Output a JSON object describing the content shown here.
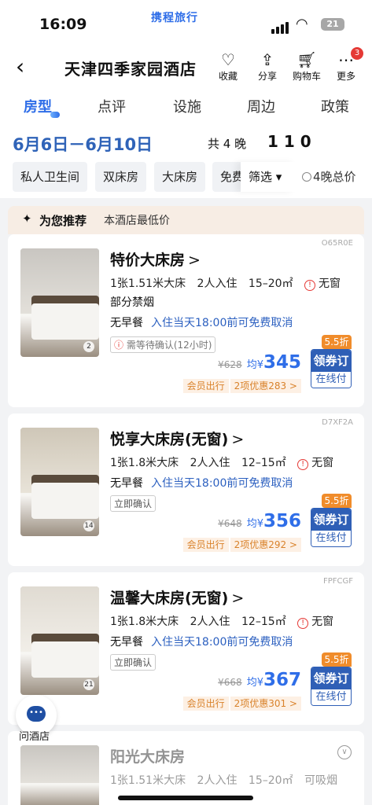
{
  "status": {
    "time": "16:09",
    "brand": "携程旅行",
    "battery": "21"
  },
  "nav": {
    "title": "天津四季家园酒店",
    "actions": [
      {
        "label": "收藏",
        "icon": "heart-icon"
      },
      {
        "label": "分享",
        "icon": "share-icon"
      },
      {
        "label": "购物车",
        "icon": "cart-icon"
      },
      {
        "label": "更多",
        "icon": "more-icon",
        "badge": "3"
      }
    ]
  },
  "tabs": [
    "房型",
    "点评",
    "设施",
    "周边",
    "政策"
  ],
  "active_tab": "房型",
  "date_bar": {
    "dates": "6月6日－6月10日",
    "nights": "共 4 晚",
    "guests": "1 1 0"
  },
  "filters": {
    "chips": [
      "私人卫生间",
      "双床房",
      "大床房",
      "免费"
    ],
    "filter_label": "筛选",
    "total_label": "4晚总价"
  },
  "recommend": {
    "title": "为您推荐",
    "subtitle": "本酒店最低价"
  },
  "rooms": [
    {
      "code": "O65R0E",
      "name": "特价大床房",
      "bed": "1张1.51米大床",
      "occupancy": "2人入住",
      "area": "15–20㎡",
      "window": "无窗",
      "extra": "部分禁烟",
      "meal": "无早餐",
      "cancel": "入住当天18:00前可免费取消",
      "confirm": "需等待确认(12小时)",
      "old_price": "¥628",
      "avg": "均¥",
      "price": "345",
      "member": "会员出行",
      "promo": "2项优惠283 >",
      "discount": "5.5折",
      "book_top": "领券订",
      "book_bottom": "在线付",
      "photos": "2"
    },
    {
      "code": "D7XF2A",
      "name": "悦享大床房(无窗)",
      "bed": "1张1.8米大床",
      "occupancy": "2人入住",
      "area": "12–15㎡",
      "window": "无窗",
      "meal": "无早餐",
      "cancel": "入住当天18:00前可免费取消",
      "confirm": "立即确认",
      "old_price": "¥648",
      "avg": "均¥",
      "price": "356",
      "member": "会员出行",
      "promo": "2项优惠292 >",
      "discount": "5.5折",
      "book_top": "领券订",
      "book_bottom": "在线付",
      "photos": "14"
    },
    {
      "code": "FPFCGF",
      "name": "温馨大床房(无窗)",
      "bed": "1张1.8米大床",
      "occupancy": "2人入住",
      "area": "12–15㎡",
      "window": "无窗",
      "meal": "无早餐",
      "cancel": "入住当天18:00前可免费取消",
      "confirm": "立即确认",
      "old_price": "¥668",
      "avg": "均¥",
      "price": "367",
      "member": "会员出行",
      "promo": "2项优惠301 >",
      "discount": "5.5折",
      "book_top": "领券订",
      "book_bottom": "在线付",
      "photos": "21"
    },
    {
      "name": "阳光大床房",
      "bed": "1张1.51米大床",
      "occupancy": "2人入住",
      "area": "15–20㎡",
      "smoking": "可吸烟"
    }
  ],
  "chat_label": "问酒店"
}
